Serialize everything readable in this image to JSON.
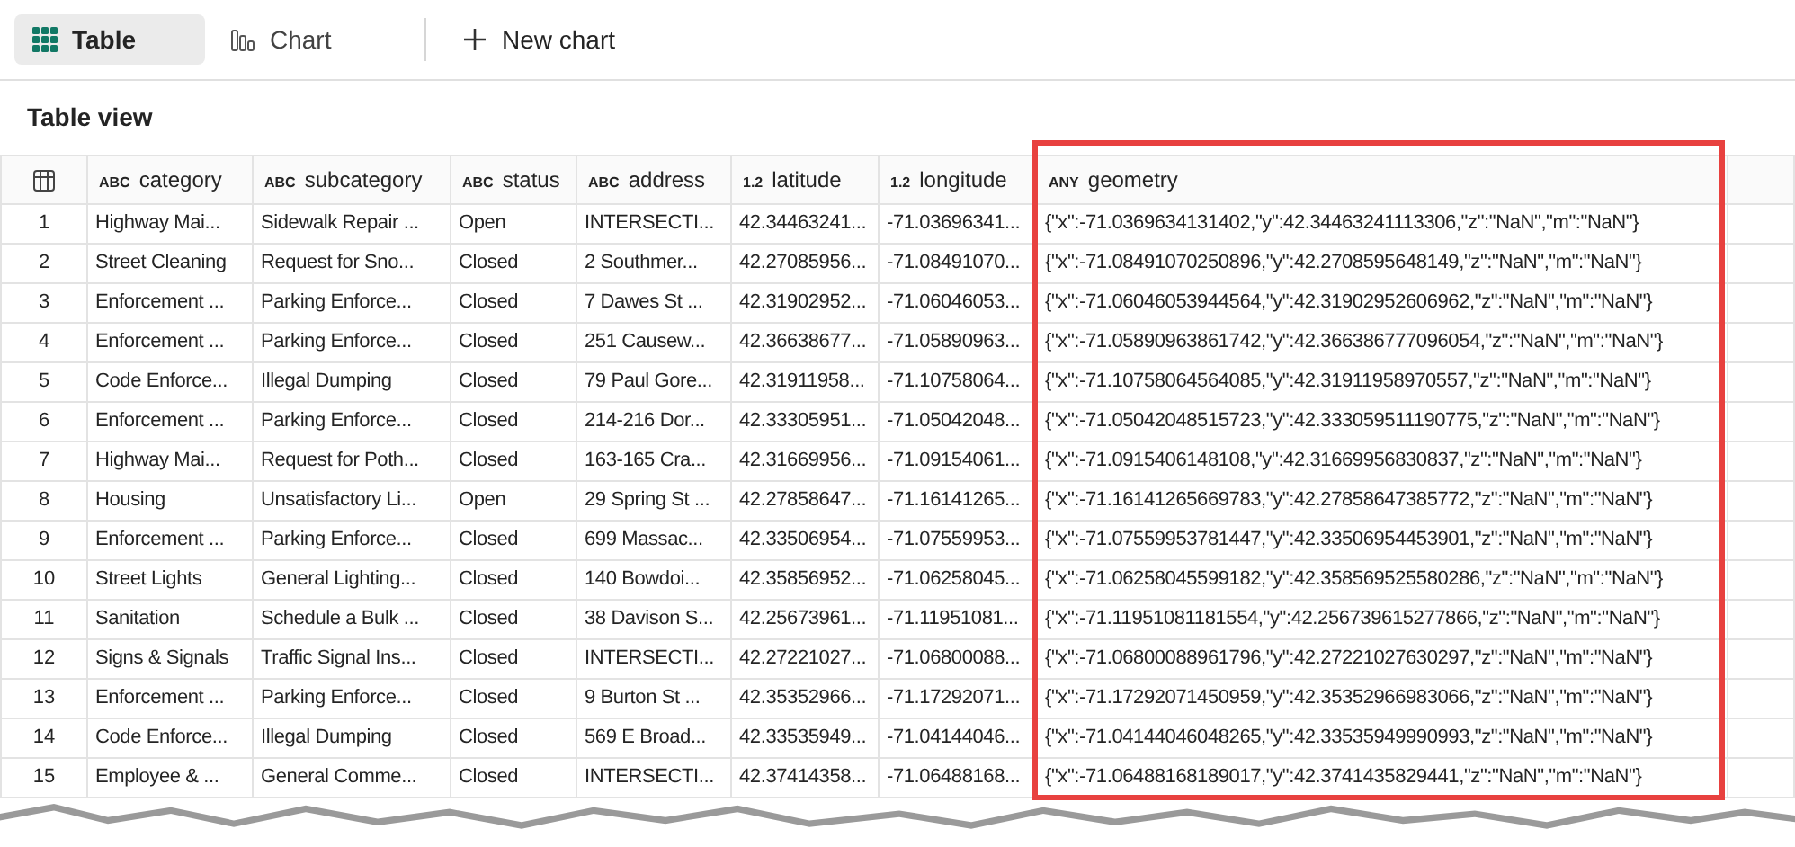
{
  "tabs": [
    {
      "label": "Table",
      "kind": "table",
      "selected": true
    },
    {
      "label": "Chart",
      "kind": "chart",
      "selected": false
    }
  ],
  "new_chart_button": {
    "label": "New chart"
  },
  "view_title": "Table view",
  "table": {
    "columns": [
      {
        "type": "ABC",
        "name": "category"
      },
      {
        "type": "ABC",
        "name": "subcategory"
      },
      {
        "type": "ABC",
        "name": "status"
      },
      {
        "type": "ABC",
        "name": "address"
      },
      {
        "type": "1.2",
        "name": "latitude"
      },
      {
        "type": "1.2",
        "name": "longitude"
      },
      {
        "type": "ANY",
        "name": "geometry",
        "highlighted": true
      }
    ],
    "rows": [
      {
        "number": "1",
        "cells": [
          "Highway Mai...",
          "Sidewalk Repair ...",
          "Open",
          "INTERSECTI...",
          "42.34463241...",
          "-71.03696341...",
          "{\"x\":-71.0369634131402,\"y\":42.34463241113306,\"z\":\"NaN\",\"m\":\"NaN\"}"
        ]
      },
      {
        "number": "2",
        "cells": [
          "Street Cleaning",
          "Request for Sno...",
          "Closed",
          "2 Southmer...",
          "42.27085956...",
          "-71.08491070...",
          "{\"x\":-71.08491070250896,\"y\":42.2708595648149,\"z\":\"NaN\",\"m\":\"NaN\"}"
        ]
      },
      {
        "number": "3",
        "cells": [
          "Enforcement ...",
          "Parking Enforce...",
          "Closed",
          "7 Dawes St ...",
          "42.31902952...",
          "-71.06046053...",
          "{\"x\":-71.06046053944564,\"y\":42.31902952606962,\"z\":\"NaN\",\"m\":\"NaN\"}"
        ]
      },
      {
        "number": "4",
        "cells": [
          "Enforcement ...",
          "Parking Enforce...",
          "Closed",
          "251 Causew...",
          "42.36638677...",
          "-71.05890963...",
          "{\"x\":-71.05890963861742,\"y\":42.366386777096054,\"z\":\"NaN\",\"m\":\"NaN\"}"
        ]
      },
      {
        "number": "5",
        "cells": [
          "Code Enforce...",
          "Illegal Dumping",
          "Closed",
          "79 Paul Gore...",
          "42.31911958...",
          "-71.10758064...",
          "{\"x\":-71.10758064564085,\"y\":42.31911958970557,\"z\":\"NaN\",\"m\":\"NaN\"}"
        ]
      },
      {
        "number": "6",
        "cells": [
          "Enforcement ...",
          "Parking Enforce...",
          "Closed",
          "214-216 Dor...",
          "42.33305951...",
          "-71.05042048...",
          "{\"x\":-71.05042048515723,\"y\":42.333059511190775,\"z\":\"NaN\",\"m\":\"NaN\"}"
        ]
      },
      {
        "number": "7",
        "cells": [
          "Highway Mai...",
          "Request for Poth...",
          "Closed",
          "163-165 Cra...",
          "42.31669956...",
          "-71.09154061...",
          "{\"x\":-71.0915406148108,\"y\":42.31669956830837,\"z\":\"NaN\",\"m\":\"NaN\"}"
        ]
      },
      {
        "number": "8",
        "cells": [
          "Housing",
          "Unsatisfactory Li...",
          "Open",
          "29 Spring St ...",
          "42.27858647...",
          "-71.16141265...",
          "{\"x\":-71.16141265669783,\"y\":42.27858647385772,\"z\":\"NaN\",\"m\":\"NaN\"}"
        ]
      },
      {
        "number": "9",
        "cells": [
          "Enforcement ...",
          "Parking Enforce...",
          "Closed",
          "699 Massac...",
          "42.33506954...",
          "-71.07559953...",
          "{\"x\":-71.07559953781447,\"y\":42.33506954453901,\"z\":\"NaN\",\"m\":\"NaN\"}"
        ]
      },
      {
        "number": "10",
        "cells": [
          "Street Lights",
          "General Lighting...",
          "Closed",
          "140 Bowdoi...",
          "42.35856952...",
          "-71.06258045...",
          "{\"x\":-71.06258045599182,\"y\":42.358569525580286,\"z\":\"NaN\",\"m\":\"NaN\"}"
        ]
      },
      {
        "number": "11",
        "cells": [
          "Sanitation",
          "Schedule a Bulk ...",
          "Closed",
          "38 Davison S...",
          "42.25673961...",
          "-71.11951081...",
          "{\"x\":-71.11951081181554,\"y\":42.256739615277866,\"z\":\"NaN\",\"m\":\"NaN\"}"
        ]
      },
      {
        "number": "12",
        "cells": [
          "Signs & Signals",
          "Traffic Signal Ins...",
          "Closed",
          "INTERSECTI...",
          "42.27221027...",
          "-71.06800088...",
          "{\"x\":-71.06800088961796,\"y\":42.27221027630297,\"z\":\"NaN\",\"m\":\"NaN\"}"
        ]
      },
      {
        "number": "13",
        "cells": [
          "Enforcement ...",
          "Parking Enforce...",
          "Closed",
          "9 Burton St ...",
          "42.35352966...",
          "-71.17292071...",
          "{\"x\":-71.17292071450959,\"y\":42.35352966983066,\"z\":\"NaN\",\"m\":\"NaN\"}"
        ]
      },
      {
        "number": "14",
        "cells": [
          "Code Enforce...",
          "Illegal Dumping",
          "Closed",
          "569 E Broad...",
          "42.33535949...",
          "-71.04144046...",
          "{\"x\":-71.04144046048265,\"y\":42.33535949990993,\"z\":\"NaN\",\"m\":\"NaN\"}"
        ]
      },
      {
        "number": "15",
        "cells": [
          "Employee & ...",
          "General Comme...",
          "Closed",
          "INTERSECTI...",
          "42.37414358...",
          "-71.06488168...",
          "{\"x\":-71.06488168189017,\"y\":42.3741435829441,\"z\":\"NaN\",\"m\":\"NaN\"}"
        ]
      }
    ]
  }
}
